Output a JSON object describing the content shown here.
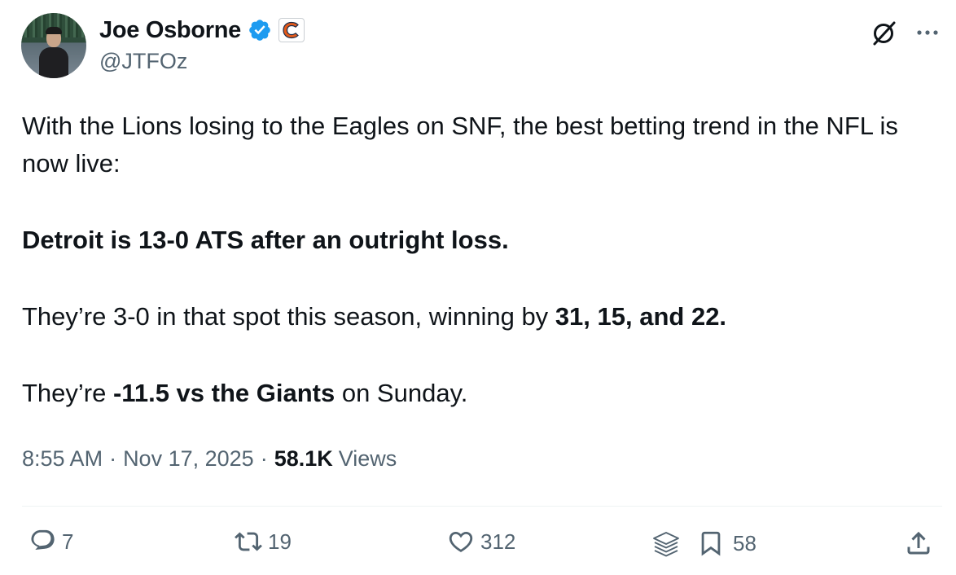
{
  "author": {
    "display_name": "Joe Osborne",
    "handle": "@JTFOz",
    "verified": true,
    "affiliation_badge_icon": "bears-c-logo-icon"
  },
  "tweet": {
    "line1": "With the Lions losing to the Eagles on SNF, the best betting trend in the NFL is now live:",
    "trend_bold": "Detroit is 13-0 ATS after an outright loss.",
    "line3_prefix": "They’re 3-0 in that spot this season, winning by ",
    "line3_bold": "31, 15, and 22.",
    "line4_prefix": "They’re ",
    "line4_bold": "-11.5 vs the Giants",
    "line4_suffix": " on Sunday."
  },
  "meta": {
    "time": "8:55 AM",
    "separator": "·",
    "date": "Nov 17, 2025",
    "views_count": "58.1K",
    "views_label": "Views"
  },
  "actions": {
    "replies": "7",
    "retweets": "19",
    "likes": "312",
    "bookmarks": "58"
  },
  "colors": {
    "text_primary": "#0f1419",
    "text_secondary": "#536471",
    "verified_blue": "#1d9bf0",
    "badge_orange": "#e35a1a"
  }
}
